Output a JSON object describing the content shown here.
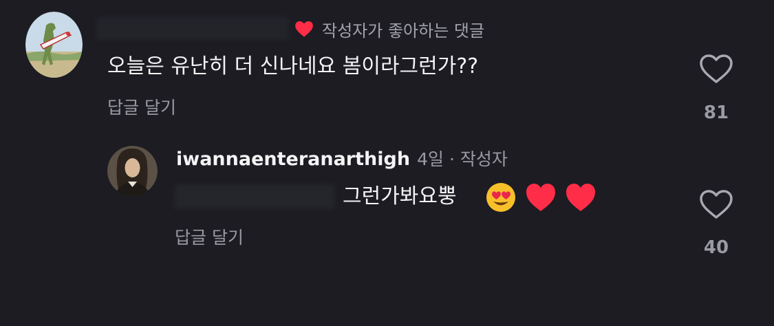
{
  "comment": {
    "liked_by_author_label": "작성자가 좋아하는 댓글",
    "text": "오늘은 유난히 더 신나네요 봄이라그런가??",
    "reply_label": "답글 달기",
    "like_count": "81"
  },
  "reply": {
    "username": "iwannaenteranarthigh",
    "time": "4일",
    "separator": "·",
    "author_badge": "작성자",
    "text": "그런가봐요뿡",
    "emojis": [
      "smiling-face-with-heart-eyes",
      "red-heart",
      "red-heart"
    ],
    "reply_label": "답글 달기",
    "like_count": "40"
  },
  "colors": {
    "background": "#1c1c22",
    "primary_text": "#f4f4f6",
    "secondary_text": "#9a9aa2",
    "heart_red": "#ff2d48"
  }
}
